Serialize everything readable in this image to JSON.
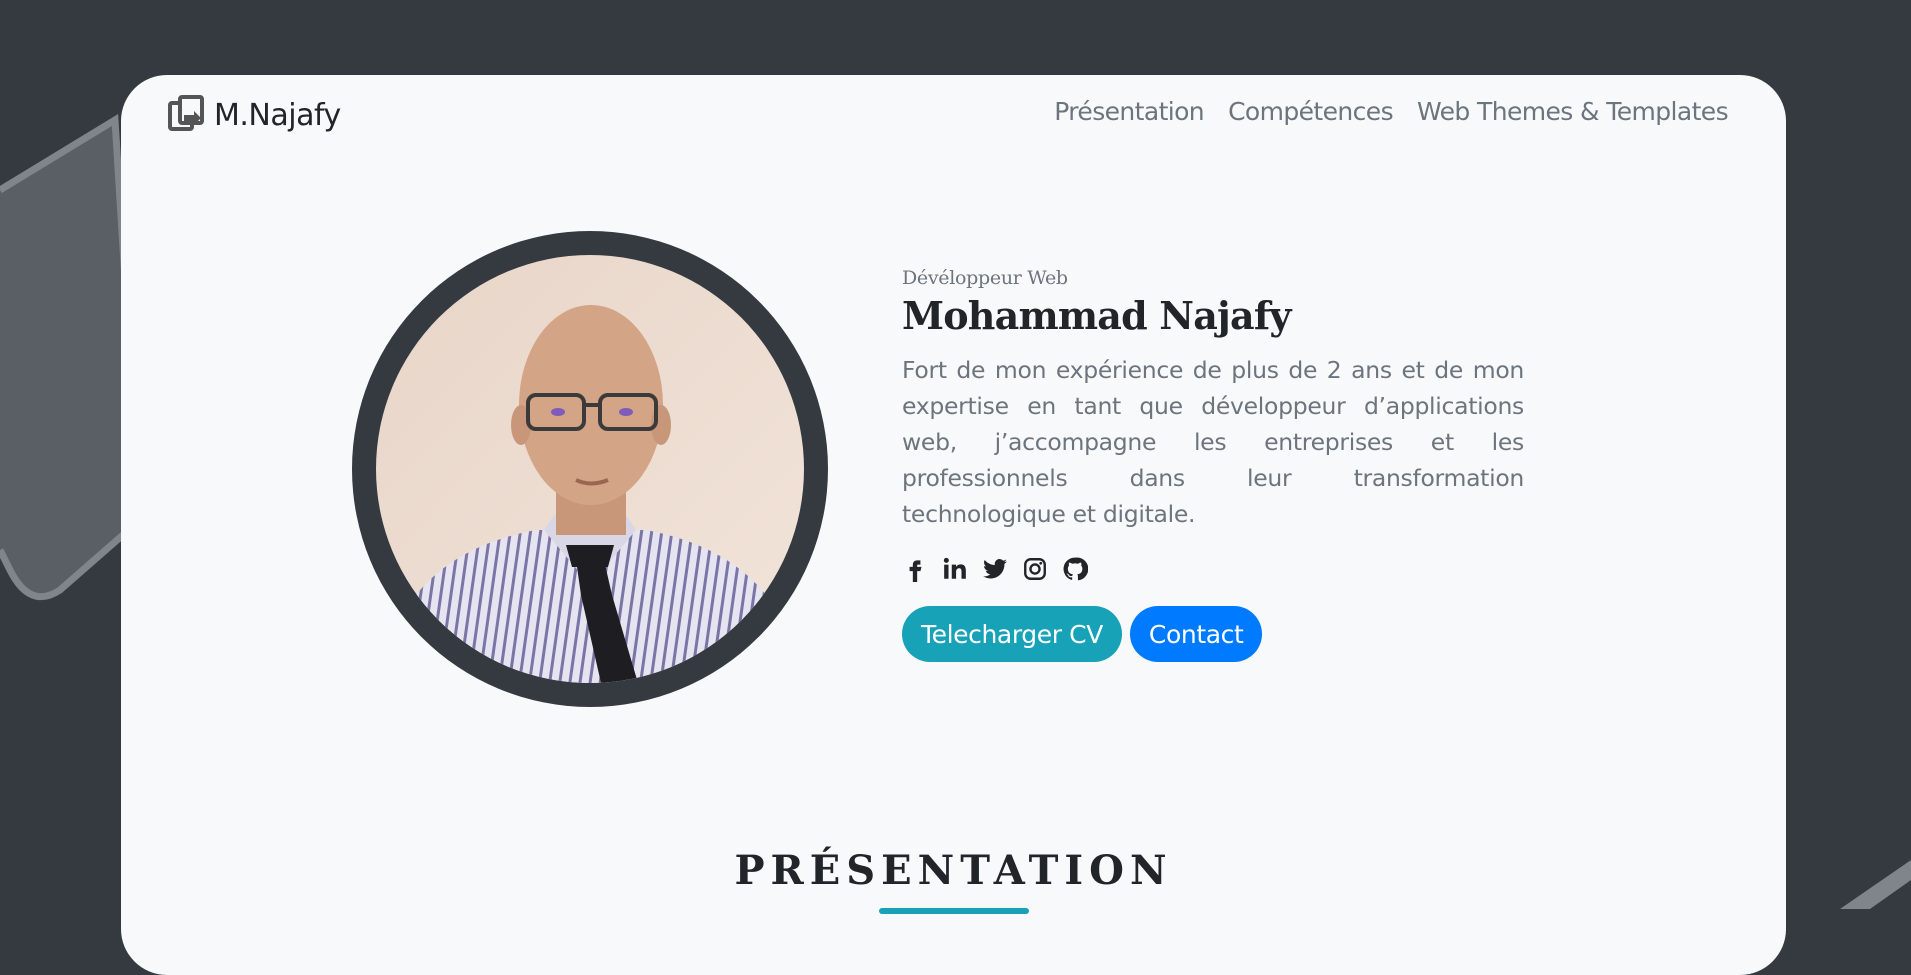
{
  "brand": {
    "name": "M.Najafy",
    "logo_icon": "share-box-icon"
  },
  "nav": {
    "items": [
      {
        "label": "Présentation"
      },
      {
        "label": "Compétences"
      },
      {
        "label": "Web Themes & Templates"
      }
    ]
  },
  "hero": {
    "subtitle": "Dévéloppeur Web",
    "name": "Mohammad Najafy",
    "bio": "Fort de mon expérience de plus de 2 ans et de mon expertise en tant que développeur d’applications web, j’accompagne les entreprises et les professionnels dans leur transformation technologique et digitale.",
    "socials": [
      "facebook-icon",
      "linkedin-icon",
      "twitter-icon",
      "instagram-icon",
      "github-icon"
    ],
    "buttons": {
      "cv": "Telecharger CV",
      "contact": "Contact"
    }
  },
  "section": {
    "title": "PRÉSENTATION"
  },
  "colors": {
    "background": "#343a40",
    "card": "#f8f9fa",
    "cv_button": "#17a2b8",
    "contact_button": "#007bff",
    "muted_text": "#6c757d"
  }
}
